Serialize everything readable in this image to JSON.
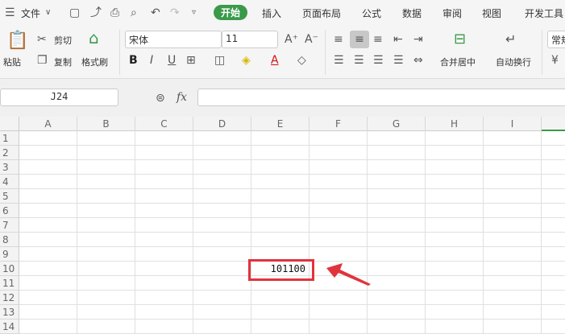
{
  "menu": {
    "file": "文件",
    "tabs": [
      "开始",
      "插入",
      "页面布局",
      "公式",
      "数据",
      "审阅",
      "视图",
      "开发工具"
    ]
  },
  "clipboard": {
    "paste": "粘贴",
    "cut": "剪切",
    "copy": "复制",
    "format_painter": "格式刷"
  },
  "font": {
    "name": "宋体",
    "size": "11",
    "bold": "B",
    "italic": "I",
    "underline": "U"
  },
  "align": {
    "merge": "合并居中",
    "wrap": "自动换行"
  },
  "number": {
    "format": "常规",
    "currency": "¥"
  },
  "formula_bar": {
    "cell_ref": "J24",
    "fx": "fx",
    "value": ""
  },
  "grid": {
    "columns": [
      "A",
      "B",
      "C",
      "D",
      "E",
      "F",
      "G",
      "H",
      "I"
    ],
    "rows": [
      "1",
      "2",
      "3",
      "4",
      "5",
      "6",
      "7",
      "8",
      "9",
      "10",
      "11",
      "12",
      "13",
      "14"
    ],
    "cell_E10": "101100"
  },
  "colors": {
    "accent": "#3a9a4a",
    "highlight": "#e0343c"
  }
}
